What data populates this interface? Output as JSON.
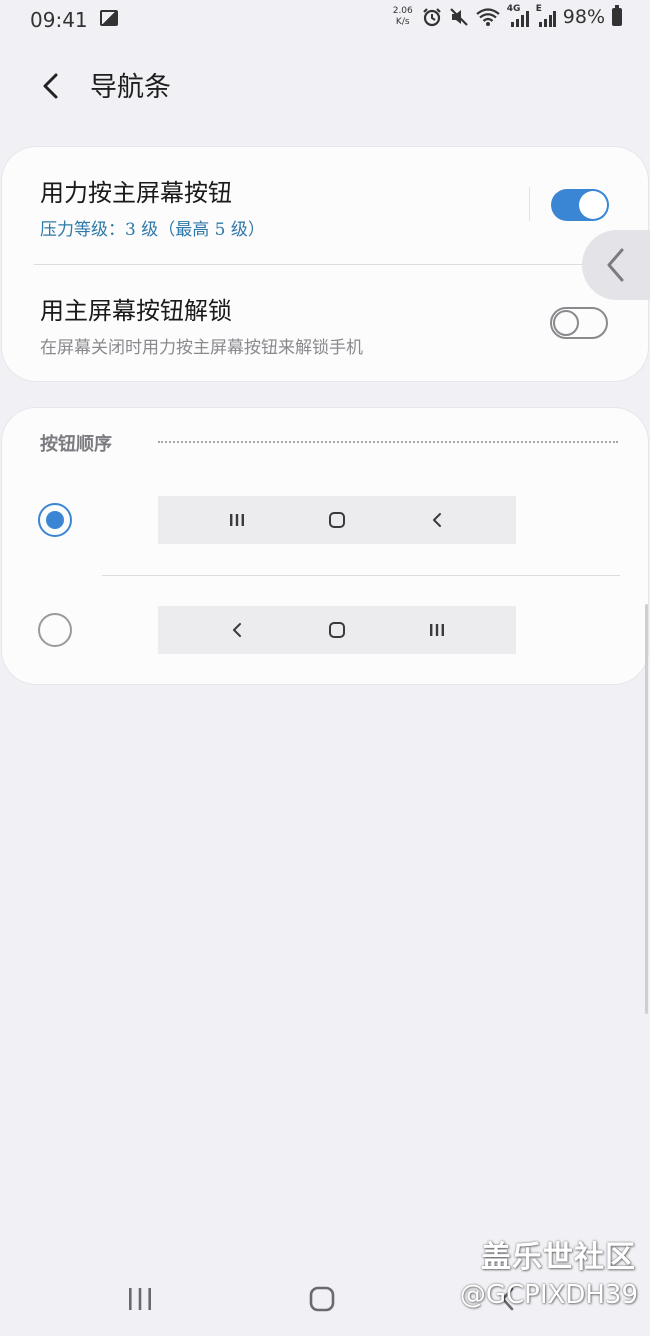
{
  "status_bar": {
    "time": "09:41",
    "net_speed_value": "2.06",
    "net_speed_unit": "K/s",
    "network_4g": "4G",
    "network_e": "E",
    "battery_percent": "98%"
  },
  "header": {
    "title": "导航条"
  },
  "pressure_setting": {
    "title": "用力按主屏幕按钮",
    "subtitle": "压力等级：3 级（最高 5 级）",
    "enabled": true
  },
  "unlock_setting": {
    "title": "用主屏幕按钮解锁",
    "subtitle": "在屏幕关闭时用力按主屏幕按钮来解锁手机",
    "enabled": false
  },
  "button_order": {
    "section_title": "按钮顺序",
    "options": [
      {
        "selected": true,
        "buttons": [
          "recents-icon",
          "home-icon",
          "back-icon"
        ]
      },
      {
        "selected": false,
        "buttons": [
          "back-icon",
          "home-icon",
          "recents-icon"
        ]
      }
    ]
  },
  "colors": {
    "accent": "#3a86d4",
    "subtitle_accent": "#2f78a8",
    "background": "#f1f0f4",
    "card": "#fcfcfd"
  },
  "watermark": {
    "title": "盖乐世社区",
    "handle": "@GCPIXDH39"
  }
}
